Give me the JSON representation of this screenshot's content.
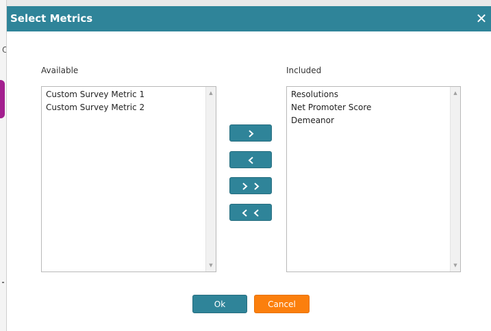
{
  "dialog": {
    "title": "Select Metrics",
    "close_glyph": "✕",
    "accent_color": "#2f8499"
  },
  "available": {
    "label": "Available",
    "items": [
      "Custom Survey Metric 1",
      "Custom Survey Metric 2"
    ]
  },
  "included": {
    "label": "Included",
    "items": [
      "Resolutions",
      "Net Promoter Score",
      "Demeanor"
    ]
  },
  "transfer_buttons": {
    "add_icon": "chevron-right-icon",
    "remove_icon": "chevron-left-icon",
    "add_all_icon": "double-chevron-right-icon",
    "remove_all_icon": "double-chevron-left-icon"
  },
  "footer": {
    "ok_label": "Ok",
    "cancel_label": "Cancel",
    "cancel_color": "#fb7f0d"
  },
  "background": {
    "edge_letter": "O"
  }
}
